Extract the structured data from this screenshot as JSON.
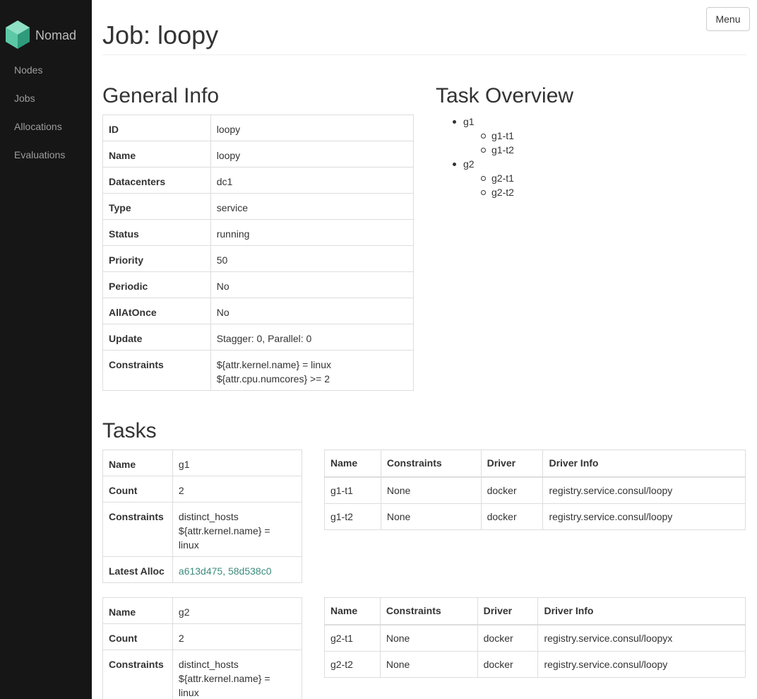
{
  "sidebar": {
    "brand": "Nomad",
    "items": [
      {
        "label": "Nodes"
      },
      {
        "label": "Jobs"
      },
      {
        "label": "Allocations"
      },
      {
        "label": "Evaluations"
      }
    ]
  },
  "header": {
    "menu_label": "Menu",
    "title": "Job: loopy"
  },
  "general_info": {
    "heading": "General Info",
    "rows": [
      {
        "key": "ID",
        "value": "loopy"
      },
      {
        "key": "Name",
        "value": "loopy"
      },
      {
        "key": "Datacenters",
        "value": "dc1"
      },
      {
        "key": "Type",
        "value": "service"
      },
      {
        "key": "Status",
        "value": "running"
      },
      {
        "key": "Priority",
        "value": "50"
      },
      {
        "key": "Periodic",
        "value": "No"
      },
      {
        "key": "AllAtOnce",
        "value": "No"
      },
      {
        "key": "Update",
        "value": "Stagger: 0, Parallel: 0"
      },
      {
        "key": "Constraints",
        "line1": "${attr.kernel.name} = linux",
        "line2": "${attr.cpu.numcores} >= 2"
      }
    ]
  },
  "task_overview": {
    "heading": "Task Overview",
    "groups": [
      {
        "name": "g1",
        "tasks": [
          "g1-t1",
          "g1-t2"
        ]
      },
      {
        "name": "g2",
        "tasks": [
          "g2-t1",
          "g2-t2"
        ]
      }
    ]
  },
  "tasks": {
    "heading": "Tasks",
    "group_labels": {
      "name": "Name",
      "count": "Count",
      "constraints": "Constraints",
      "latest_alloc": "Latest Alloc"
    },
    "task_columns": [
      "Name",
      "Constraints",
      "Driver",
      "Driver Info"
    ],
    "groups": [
      {
        "name": "g1",
        "count": "2",
        "constraints": [
          "distinct_hosts",
          "${attr.kernel.name} =",
          "linux"
        ],
        "latest_alloc": "a613d475, 58d538c0",
        "tasks": [
          {
            "name": "g1-t1",
            "constraints": "None",
            "driver": "docker",
            "driver_info": "registry.service.consul/loopy"
          },
          {
            "name": "g1-t2",
            "constraints": "None",
            "driver": "docker",
            "driver_info": "registry.service.consul/loopy"
          }
        ]
      },
      {
        "name": "g2",
        "count": "2",
        "constraints": [
          "distinct_hosts",
          "${attr.kernel.name} =",
          "linux"
        ],
        "tasks": [
          {
            "name": "g2-t1",
            "constraints": "None",
            "driver": "docker",
            "driver_info": "registry.service.consul/loopyx"
          },
          {
            "name": "g2-t2",
            "constraints": "None",
            "driver": "docker",
            "driver_info": "registry.service.consul/loopy"
          }
        ]
      }
    ]
  }
}
